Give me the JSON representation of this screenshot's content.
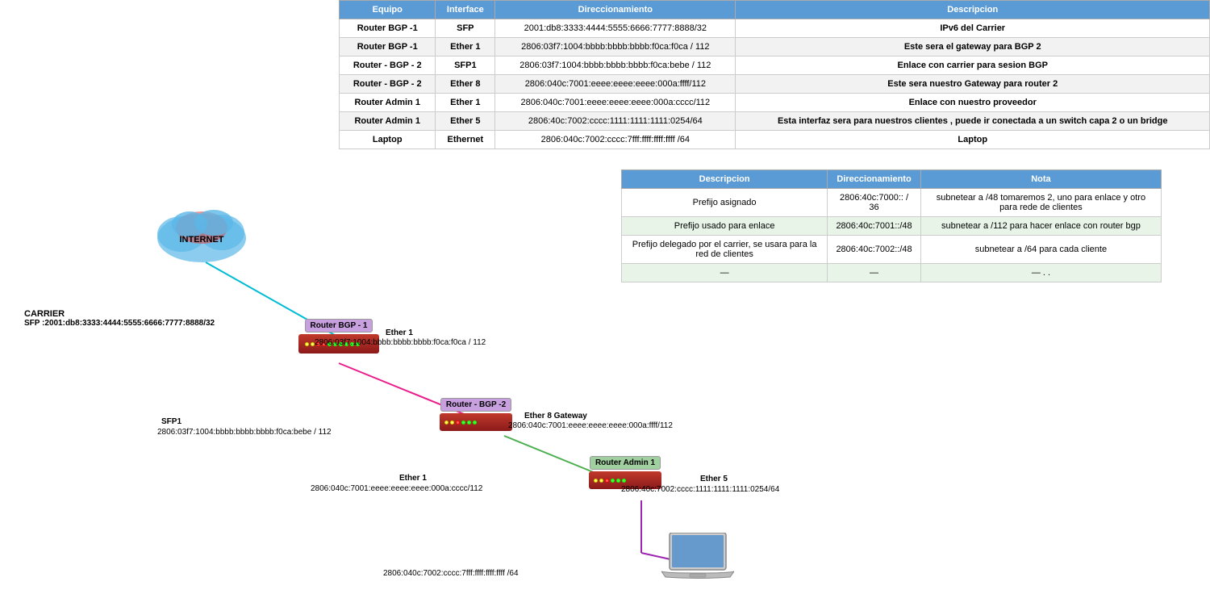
{
  "table": {
    "headers": [
      "Equipo",
      "Interface",
      "Direccionamiento",
      "Descripcion"
    ],
    "rows": [
      {
        "equipo": "Router BGP -1",
        "interface": "SFP",
        "direccionamiento": "2001:db8:3333:4444:5555:6666:7777:8888/32",
        "descripcion": "IPv6 del Carrier"
      },
      {
        "equipo": "Router BGP -1",
        "interface": "Ether 1",
        "direccionamiento": "2806:03f7:1004:bbbb:bbbb:bbbb:f0ca:f0ca / 112",
        "descripcion": "Este sera el gateway para BGP 2"
      },
      {
        "equipo": "Router - BGP - 2",
        "interface": "SFP1",
        "direccionamiento": "2806:03f7:1004:bbbb:bbbb:bbbb:f0ca:bebe / 112",
        "descripcion": "Enlace con carrier para sesion BGP"
      },
      {
        "equipo": "Router - BGP - 2",
        "interface": "Ether 8",
        "direccionamiento": "2806:040c:7001:eeee:eeee:eeee:000a:ffff/112",
        "descripcion": "Este sera nuestro Gateway para router 2"
      },
      {
        "equipo": "Router Admin 1",
        "interface": "Ether 1",
        "direccionamiento": "2806:040c:7001:eeee:eeee:eeee:000a:cccc/112",
        "descripcion": "Enlace con nuestro proveedor"
      },
      {
        "equipo": "Router Admin 1",
        "interface": "Ether 5",
        "direccionamiento": "2806:40c:7002:cccc:1111:1111:1111:0254/64",
        "descripcion": "Esta interfaz sera para nuestros clientes , puede ir conectada a un switch capa 2 o un bridge"
      },
      {
        "equipo": "Laptop",
        "interface": "Ethernet",
        "direccionamiento": "2806:040c:7002:cccc:7fff:ffff:ffff:ffff /64",
        "descripcion": "Laptop"
      }
    ]
  },
  "second_table": {
    "headers": [
      "Descripcion",
      "Direccionamiento",
      "Nota"
    ],
    "rows": [
      {
        "descripcion": "Prefijo asignado",
        "direccionamiento": "2806:40c:7000:: / 36",
        "nota": "subnetear a /48  tomaremos 2, uno para enlace y otro para rede de clientes"
      },
      {
        "descripcion": "Prefijo usado para enlace",
        "direccionamiento": "2806:40c:7001::/48",
        "nota": "subnetear a /112 para hacer enlace con router bgp"
      },
      {
        "descripcion": "Prefijo delegado por el carrier, se usara para la red de clientes",
        "direccionamiento": "2806:40c:7002::/48",
        "nota": "subnetear a /64 para cada cliente"
      },
      {
        "descripcion": "—",
        "direccionamiento": "—",
        "nota": "— . ."
      }
    ]
  },
  "diagram": {
    "internet_label": "INTERNET",
    "carrier_label": "CARRIER",
    "carrier_addr": "SFP :2001:db8:3333:4444:5555:6666:7777:8888/32",
    "router_bgp1": {
      "label": "Router BGP - 1",
      "ether1_label": "Ether 1",
      "ether1_addr": "2806:03f7:1004:bbbb:bbbb:bbbb:f0ca:f0ca / 112"
    },
    "router_bgp2": {
      "label": "Router - BGP -2",
      "sfp1_label": "SFP1",
      "sfp1_addr": "2806:03f7:1004:bbbb:bbbb:bbbb:f0ca:bebe / 112",
      "ether8_label": "Ether 8 Gateway",
      "ether8_addr": "2806:040c:7001:eeee:eeee:eeee:000a:ffff/112"
    },
    "router_admin1": {
      "label": "Router Admin 1",
      "ether1_label": "Ether 1",
      "ether1_addr": "2806:040c:7001:eeee:eeee:eeee:000a:cccc/112",
      "ether5_label": "Ether 5",
      "ether5_addr": "2806:40c:7002:cccc:1111:1111:1111:0254/64"
    },
    "laptop": {
      "addr": "2806:040c:7002:cccc:7fff:ffff:ffff:ffff /64"
    }
  }
}
